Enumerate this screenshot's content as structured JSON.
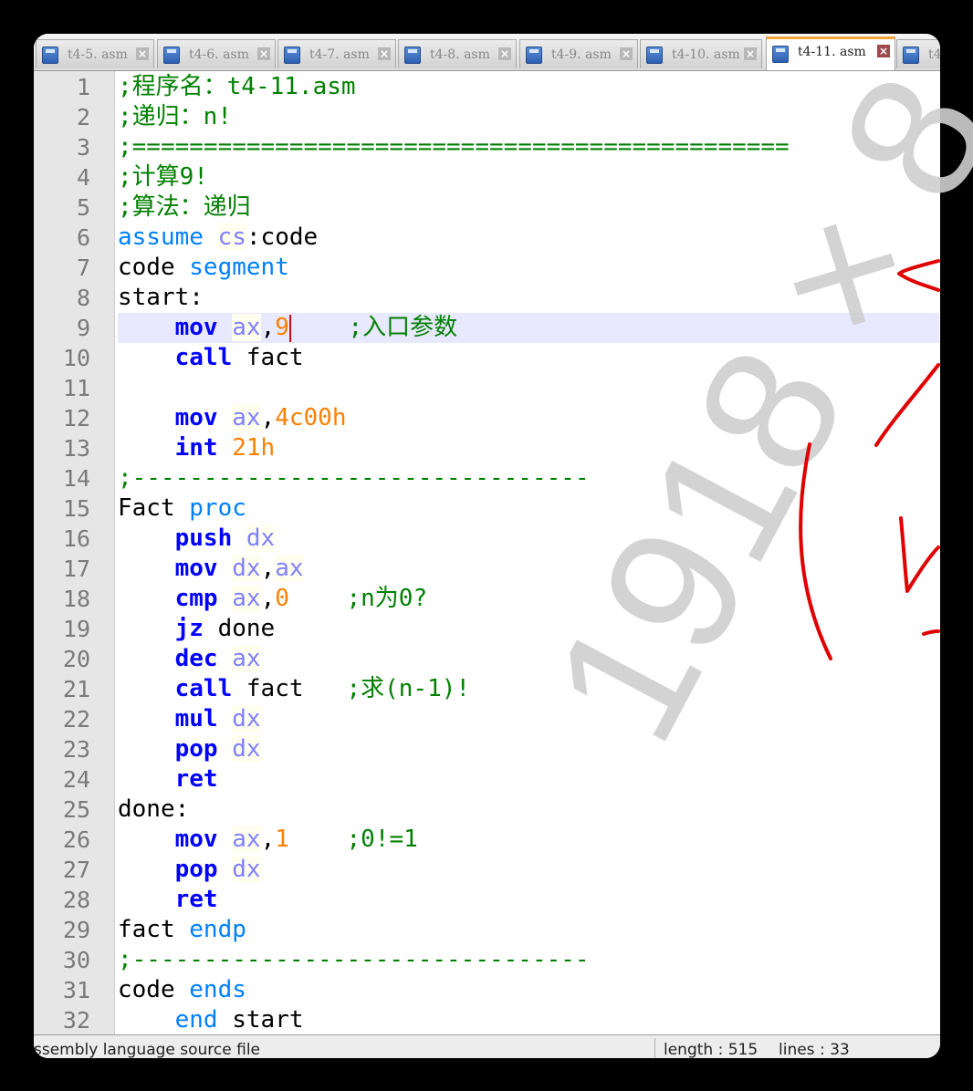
{
  "tabs": [
    {
      "label": "t4-5. asm",
      "active": false
    },
    {
      "label": "t4-6. asm",
      "active": false
    },
    {
      "label": "t4-7. asm",
      "active": false
    },
    {
      "label": "t4-8. asm",
      "active": false
    },
    {
      "label": "t4-9. asm",
      "active": false
    },
    {
      "label": "t4-10. asm",
      "active": false
    },
    {
      "label": "t4-11. asm",
      "active": true
    },
    {
      "label": "t4",
      "active": false
    }
  ],
  "editor": {
    "current_line": 9,
    "lines": [
      {
        "n": "1",
        "tokens": [
          [
            "cm",
            ";程序名：t4-11.asm"
          ]
        ]
      },
      {
        "n": "2",
        "tokens": [
          [
            "cm",
            ";递归：n!"
          ]
        ]
      },
      {
        "n": "3",
        "tokens": [
          [
            "cm",
            ";=============================================="
          ]
        ]
      },
      {
        "n": "4",
        "tokens": [
          [
            "cm",
            ";计算9!"
          ]
        ]
      },
      {
        "n": "5",
        "tokens": [
          [
            "cm",
            ";算法：递归"
          ]
        ]
      },
      {
        "n": "6",
        "tokens": [
          [
            "dr",
            "assume"
          ],
          [
            "pl",
            " "
          ],
          [
            "rg",
            "cs"
          ],
          [
            "pl",
            ":code"
          ]
        ]
      },
      {
        "n": "7",
        "tokens": [
          [
            "pl",
            "code "
          ],
          [
            "dr",
            "segment"
          ]
        ]
      },
      {
        "n": "8",
        "tokens": [
          [
            "pl",
            "start:"
          ]
        ]
      },
      {
        "n": "9",
        "tokens": [
          [
            "pl",
            "    "
          ],
          [
            "kw",
            "mov"
          ],
          [
            "pl",
            " "
          ],
          [
            "rg",
            "ax"
          ],
          [
            "pl",
            ","
          ],
          [
            "nm",
            "9"
          ],
          [
            "caret",
            ""
          ],
          [
            "pl",
            "    "
          ],
          [
            "cm",
            ";入口参数"
          ]
        ]
      },
      {
        "n": "10",
        "tokens": [
          [
            "pl",
            "    "
          ],
          [
            "kw",
            "call"
          ],
          [
            "pl",
            " fact"
          ]
        ]
      },
      {
        "n": "11",
        "tokens": []
      },
      {
        "n": "12",
        "tokens": [
          [
            "pl",
            "    "
          ],
          [
            "kw",
            "mov"
          ],
          [
            "pl",
            " "
          ],
          [
            "rg",
            "ax"
          ],
          [
            "pl",
            ","
          ],
          [
            "nm",
            "4c00h"
          ]
        ]
      },
      {
        "n": "13",
        "tokens": [
          [
            "pl",
            "    "
          ],
          [
            "kw",
            "int"
          ],
          [
            "pl",
            " "
          ],
          [
            "nm",
            "21h"
          ]
        ]
      },
      {
        "n": "14",
        "tokens": [
          [
            "cm",
            ";--------------------------------"
          ]
        ]
      },
      {
        "n": "15",
        "tokens": [
          [
            "pl",
            "Fact "
          ],
          [
            "dr",
            "proc"
          ]
        ]
      },
      {
        "n": "16",
        "tokens": [
          [
            "pl",
            "    "
          ],
          [
            "kw",
            "push"
          ],
          [
            "pl",
            " "
          ],
          [
            "rg",
            "dx"
          ]
        ]
      },
      {
        "n": "17",
        "tokens": [
          [
            "pl",
            "    "
          ],
          [
            "kw",
            "mov"
          ],
          [
            "pl",
            " "
          ],
          [
            "rg",
            "dx"
          ],
          [
            "pl",
            ","
          ],
          [
            "rg",
            "ax"
          ]
        ]
      },
      {
        "n": "18",
        "tokens": [
          [
            "pl",
            "    "
          ],
          [
            "kw",
            "cmp"
          ],
          [
            "pl",
            " "
          ],
          [
            "rg",
            "ax"
          ],
          [
            "pl",
            ","
          ],
          [
            "nm",
            "0"
          ],
          [
            "pl",
            "    "
          ],
          [
            "cm",
            ";n为0?"
          ]
        ]
      },
      {
        "n": "19",
        "tokens": [
          [
            "pl",
            "    "
          ],
          [
            "kw",
            "jz"
          ],
          [
            "pl",
            " done"
          ]
        ]
      },
      {
        "n": "20",
        "tokens": [
          [
            "pl",
            "    "
          ],
          [
            "kw",
            "dec"
          ],
          [
            "pl",
            " "
          ],
          [
            "rg",
            "ax"
          ]
        ]
      },
      {
        "n": "21",
        "tokens": [
          [
            "pl",
            "    "
          ],
          [
            "kw",
            "call"
          ],
          [
            "pl",
            " fact   "
          ],
          [
            "cm",
            ";求(n-1)!"
          ]
        ]
      },
      {
        "n": "22",
        "tokens": [
          [
            "pl",
            "    "
          ],
          [
            "kw",
            "mul"
          ],
          [
            "pl",
            " "
          ],
          [
            "rg",
            "dx"
          ]
        ]
      },
      {
        "n": "23",
        "tokens": [
          [
            "pl",
            "    "
          ],
          [
            "kw",
            "pop"
          ],
          [
            "pl",
            " "
          ],
          [
            "rg",
            "dx"
          ]
        ]
      },
      {
        "n": "24",
        "tokens": [
          [
            "pl",
            "    "
          ],
          [
            "kw",
            "ret"
          ]
        ]
      },
      {
        "n": "25",
        "tokens": [
          [
            "pl",
            "done:"
          ]
        ]
      },
      {
        "n": "26",
        "tokens": [
          [
            "pl",
            "    "
          ],
          [
            "kw",
            "mov"
          ],
          [
            "pl",
            " "
          ],
          [
            "rg",
            "ax"
          ],
          [
            "pl",
            ","
          ],
          [
            "nm",
            "1"
          ],
          [
            "pl",
            "    "
          ],
          [
            "cm",
            ";0!=1"
          ]
        ]
      },
      {
        "n": "27",
        "tokens": [
          [
            "pl",
            "    "
          ],
          [
            "kw",
            "pop"
          ],
          [
            "pl",
            " "
          ],
          [
            "rg",
            "dx"
          ]
        ]
      },
      {
        "n": "28",
        "tokens": [
          [
            "pl",
            "    "
          ],
          [
            "kw",
            "ret"
          ]
        ]
      },
      {
        "n": "29",
        "tokens": [
          [
            "pl",
            "fact "
          ],
          [
            "dr",
            "endp"
          ]
        ]
      },
      {
        "n": "30",
        "tokens": [
          [
            "cm",
            ";--------------------------------"
          ]
        ]
      },
      {
        "n": "31",
        "tokens": [
          [
            "pl",
            "code "
          ],
          [
            "dr",
            "ends"
          ]
        ]
      },
      {
        "n": "32",
        "tokens": [
          [
            "pl",
            "    "
          ],
          [
            "dr",
            "end"
          ],
          [
            "pl",
            " start"
          ]
        ]
      }
    ]
  },
  "status": {
    "file_type": "ssembly language source file",
    "length": "length : 515",
    "lines": "lines : 33"
  },
  "watermark": "1918 × 8",
  "colors": {
    "comment": "#008000",
    "keyword": "#0000ff",
    "directive": "#0080ff",
    "register": "#8080ff",
    "number": "#ff8000",
    "current_line": "#e8e8ff",
    "active_tab_accent": "#f5a53a",
    "ink": "#e00000"
  }
}
